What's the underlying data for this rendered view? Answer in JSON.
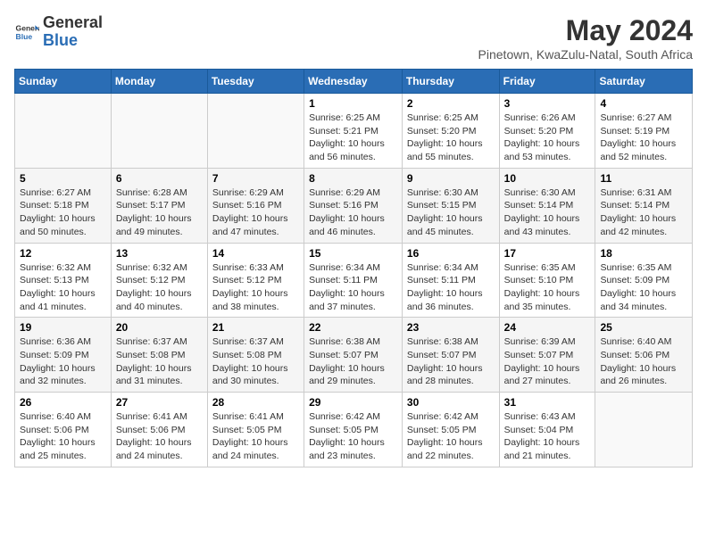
{
  "logo": {
    "line1": "General",
    "line2": "Blue"
  },
  "title": "May 2024",
  "subtitle": "Pinetown, KwaZulu-Natal, South Africa",
  "days_header": [
    "Sunday",
    "Monday",
    "Tuesday",
    "Wednesday",
    "Thursday",
    "Friday",
    "Saturday"
  ],
  "weeks": [
    [
      {
        "num": "",
        "info": ""
      },
      {
        "num": "",
        "info": ""
      },
      {
        "num": "",
        "info": ""
      },
      {
        "num": "1",
        "info": "Sunrise: 6:25 AM\nSunset: 5:21 PM\nDaylight: 10 hours\nand 56 minutes."
      },
      {
        "num": "2",
        "info": "Sunrise: 6:25 AM\nSunset: 5:20 PM\nDaylight: 10 hours\nand 55 minutes."
      },
      {
        "num": "3",
        "info": "Sunrise: 6:26 AM\nSunset: 5:20 PM\nDaylight: 10 hours\nand 53 minutes."
      },
      {
        "num": "4",
        "info": "Sunrise: 6:27 AM\nSunset: 5:19 PM\nDaylight: 10 hours\nand 52 minutes."
      }
    ],
    [
      {
        "num": "5",
        "info": "Sunrise: 6:27 AM\nSunset: 5:18 PM\nDaylight: 10 hours\nand 50 minutes."
      },
      {
        "num": "6",
        "info": "Sunrise: 6:28 AM\nSunset: 5:17 PM\nDaylight: 10 hours\nand 49 minutes."
      },
      {
        "num": "7",
        "info": "Sunrise: 6:29 AM\nSunset: 5:16 PM\nDaylight: 10 hours\nand 47 minutes."
      },
      {
        "num": "8",
        "info": "Sunrise: 6:29 AM\nSunset: 5:16 PM\nDaylight: 10 hours\nand 46 minutes."
      },
      {
        "num": "9",
        "info": "Sunrise: 6:30 AM\nSunset: 5:15 PM\nDaylight: 10 hours\nand 45 minutes."
      },
      {
        "num": "10",
        "info": "Sunrise: 6:30 AM\nSunset: 5:14 PM\nDaylight: 10 hours\nand 43 minutes."
      },
      {
        "num": "11",
        "info": "Sunrise: 6:31 AM\nSunset: 5:14 PM\nDaylight: 10 hours\nand 42 minutes."
      }
    ],
    [
      {
        "num": "12",
        "info": "Sunrise: 6:32 AM\nSunset: 5:13 PM\nDaylight: 10 hours\nand 41 minutes."
      },
      {
        "num": "13",
        "info": "Sunrise: 6:32 AM\nSunset: 5:12 PM\nDaylight: 10 hours\nand 40 minutes."
      },
      {
        "num": "14",
        "info": "Sunrise: 6:33 AM\nSunset: 5:12 PM\nDaylight: 10 hours\nand 38 minutes."
      },
      {
        "num": "15",
        "info": "Sunrise: 6:34 AM\nSunset: 5:11 PM\nDaylight: 10 hours\nand 37 minutes."
      },
      {
        "num": "16",
        "info": "Sunrise: 6:34 AM\nSunset: 5:11 PM\nDaylight: 10 hours\nand 36 minutes."
      },
      {
        "num": "17",
        "info": "Sunrise: 6:35 AM\nSunset: 5:10 PM\nDaylight: 10 hours\nand 35 minutes."
      },
      {
        "num": "18",
        "info": "Sunrise: 6:35 AM\nSunset: 5:09 PM\nDaylight: 10 hours\nand 34 minutes."
      }
    ],
    [
      {
        "num": "19",
        "info": "Sunrise: 6:36 AM\nSunset: 5:09 PM\nDaylight: 10 hours\nand 32 minutes."
      },
      {
        "num": "20",
        "info": "Sunrise: 6:37 AM\nSunset: 5:08 PM\nDaylight: 10 hours\nand 31 minutes."
      },
      {
        "num": "21",
        "info": "Sunrise: 6:37 AM\nSunset: 5:08 PM\nDaylight: 10 hours\nand 30 minutes."
      },
      {
        "num": "22",
        "info": "Sunrise: 6:38 AM\nSunset: 5:07 PM\nDaylight: 10 hours\nand 29 minutes."
      },
      {
        "num": "23",
        "info": "Sunrise: 6:38 AM\nSunset: 5:07 PM\nDaylight: 10 hours\nand 28 minutes."
      },
      {
        "num": "24",
        "info": "Sunrise: 6:39 AM\nSunset: 5:07 PM\nDaylight: 10 hours\nand 27 minutes."
      },
      {
        "num": "25",
        "info": "Sunrise: 6:40 AM\nSunset: 5:06 PM\nDaylight: 10 hours\nand 26 minutes."
      }
    ],
    [
      {
        "num": "26",
        "info": "Sunrise: 6:40 AM\nSunset: 5:06 PM\nDaylight: 10 hours\nand 25 minutes."
      },
      {
        "num": "27",
        "info": "Sunrise: 6:41 AM\nSunset: 5:06 PM\nDaylight: 10 hours\nand 24 minutes."
      },
      {
        "num": "28",
        "info": "Sunrise: 6:41 AM\nSunset: 5:05 PM\nDaylight: 10 hours\nand 24 minutes."
      },
      {
        "num": "29",
        "info": "Sunrise: 6:42 AM\nSunset: 5:05 PM\nDaylight: 10 hours\nand 23 minutes."
      },
      {
        "num": "30",
        "info": "Sunrise: 6:42 AM\nSunset: 5:05 PM\nDaylight: 10 hours\nand 22 minutes."
      },
      {
        "num": "31",
        "info": "Sunrise: 6:43 AM\nSunset: 5:04 PM\nDaylight: 10 hours\nand 21 minutes."
      },
      {
        "num": "",
        "info": ""
      }
    ]
  ]
}
